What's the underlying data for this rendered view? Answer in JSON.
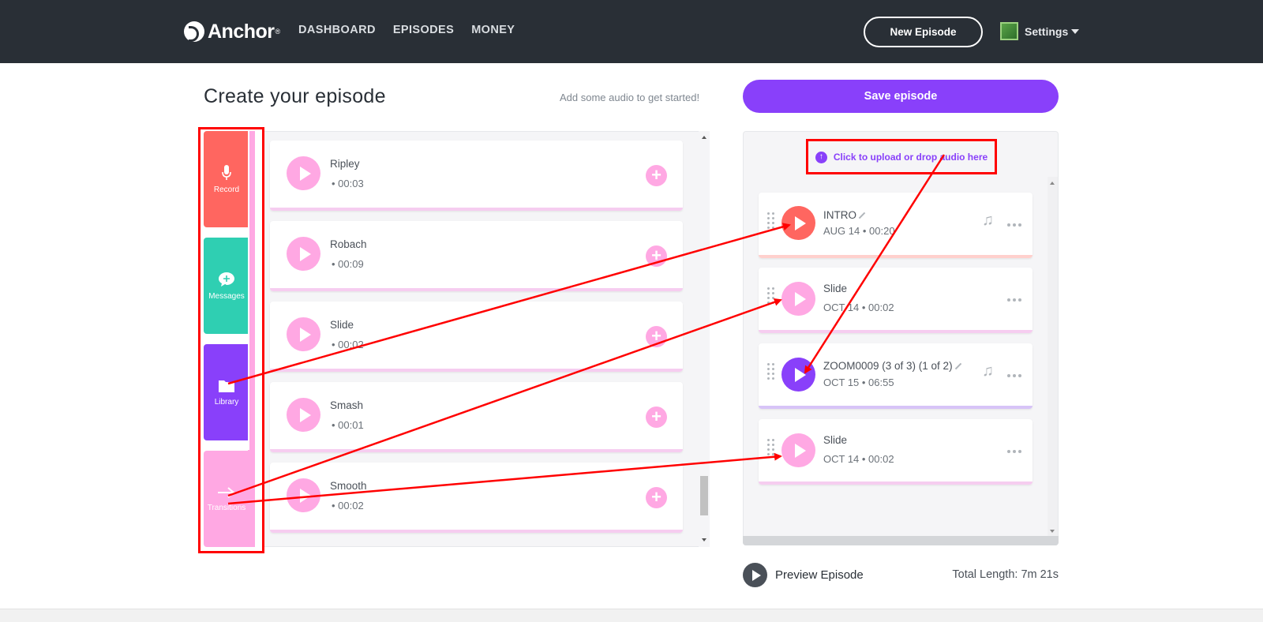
{
  "header": {
    "logo_text": "Anchor",
    "logo_mark": "®",
    "nav": [
      "DASHBOARD",
      "EPISODES",
      "MONEY"
    ],
    "new_episode_label": "New Episode",
    "settings_label": "Settings"
  },
  "main": {
    "title": "Create your episode",
    "hint": "Add some audio to get started!",
    "save_label": "Save episode"
  },
  "tools": [
    {
      "label": "Record",
      "icon": "microphone-icon"
    },
    {
      "label": "Messages",
      "icon": "message-bubble-icon"
    },
    {
      "label": "Library",
      "icon": "folder-icon"
    },
    {
      "label": "Transitions",
      "icon": "transition-arrow-icon"
    }
  ],
  "library": [
    {
      "title": "Ripley",
      "duration": "• 00:03"
    },
    {
      "title": "Robach",
      "duration": "• 00:09"
    },
    {
      "title": "Slide",
      "duration": "• 00:02"
    },
    {
      "title": "Smash",
      "duration": "• 00:01"
    },
    {
      "title": "Smooth",
      "duration": "• 00:02"
    }
  ],
  "episode": {
    "upload_label": "Click to upload or drop audio here",
    "segments": [
      {
        "title": "INTRO",
        "meta": "AUG 14 • 00:20",
        "color": "#ff6660"
      },
      {
        "title": "Slide",
        "meta": "OCT 14 • 00:02",
        "color": "#ffa8e3"
      },
      {
        "title": "ZOOM0009 (3 of 3) (1 of 2)",
        "meta": "OCT 15 • 06:55",
        "color": "#8940fa"
      },
      {
        "title": "Slide",
        "meta": "OCT 14 • 00:02",
        "color": "#ffa8e3"
      }
    ],
    "preview_label": "Preview Episode",
    "total_length": "Total Length: 7m 21s"
  },
  "colors": {
    "brand_purple": "#8940fa",
    "record_red": "#ff6660",
    "messages_teal": "#2fcfb2",
    "transitions_pink": "#ffa8e3",
    "header_dark": "#292f36",
    "annotation_red": "#ff0000"
  }
}
